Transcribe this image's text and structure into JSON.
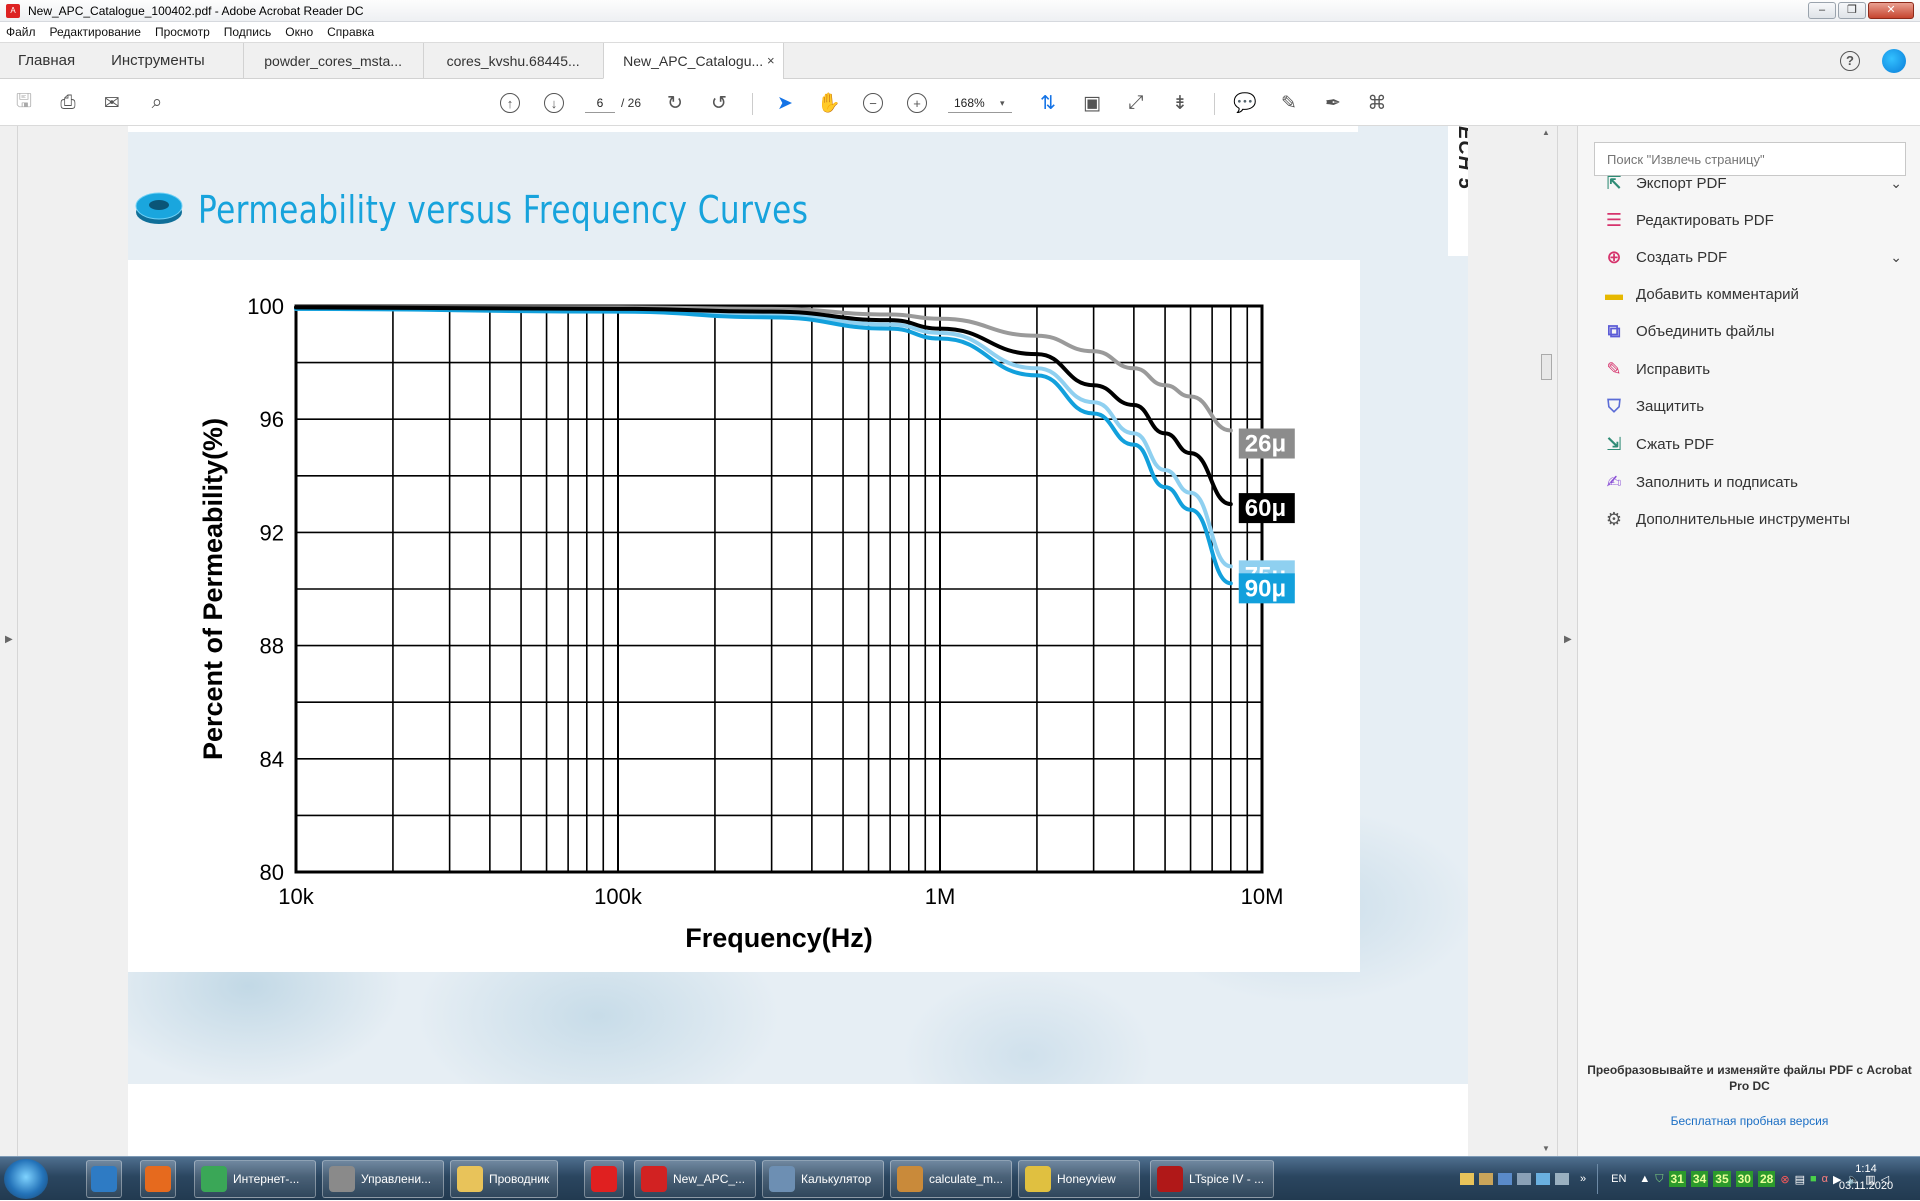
{
  "window": {
    "title": "New_APC_Catalogue_100402.pdf - Adobe Acrobat Reader DC",
    "controls": {
      "minimize": "–",
      "maximize": "❐",
      "close": "✕"
    }
  },
  "menu": [
    "Файл",
    "Редактирование",
    "Просмотр",
    "Подпись",
    "Окно",
    "Справка"
  ],
  "tabs": {
    "home": "Главная",
    "tools": "Инструменты",
    "documents": [
      {
        "label": "powder_cores_msta...",
        "active": false
      },
      {
        "label": "cores_kvshu.68445...",
        "active": false
      },
      {
        "label": "New_APC_Catalogu...",
        "active": true
      }
    ],
    "close_glyph": "×",
    "help": "?"
  },
  "toolbar": {
    "page_current": "6",
    "page_separator": "/ 26",
    "zoom": "168%",
    "zoom_arrow": "▾",
    "icons": [
      "save-icon",
      "print-icon",
      "mail-icon",
      "search-icon",
      "prev-page-icon",
      "next-page-icon",
      "rotate-cw-icon",
      "rotate-ccw-icon",
      "select-cursor-icon",
      "hand-icon",
      "zoom-out-icon",
      "zoom-in-icon",
      "fit-page-icon",
      "page-thumbnail-icon",
      "fullscreen-icon",
      "scroll-mode-icon",
      "comment-icon",
      "highlight-icon",
      "sign-icon",
      "stamp-icon"
    ]
  },
  "document": {
    "side_tab_text": "ECH 5",
    "section_title": "Permeability versus Frequency Curves",
    "accent_color": "#17a3dc"
  },
  "chart_data": {
    "type": "line",
    "title": "",
    "xlabel": "Frequency(Hz)",
    "ylabel": "Percent of Permeability(%)",
    "xscale": "log",
    "xlim": [
      10000,
      10000000
    ],
    "ylim": [
      80,
      100
    ],
    "x_ticks": [
      {
        "value": 10000,
        "label": "10k"
      },
      {
        "value": 100000,
        "label": "100k"
      },
      {
        "value": 1000000,
        "label": "1M"
      },
      {
        "value": 10000000,
        "label": "10M"
      }
    ],
    "y_ticks": [
      100,
      96,
      92,
      88,
      84,
      80
    ],
    "grid": true,
    "series": [
      {
        "name": "26μ",
        "color": "#9a9a9a",
        "label_color": "#8c8c8c",
        "points": [
          [
            10000,
            99.95
          ],
          [
            100000,
            99.95
          ],
          [
            300000,
            99.9
          ],
          [
            700000,
            99.7
          ],
          [
            1000000,
            99.55
          ],
          [
            2000000,
            98.95
          ],
          [
            3000000,
            98.4
          ],
          [
            4000000,
            97.8
          ],
          [
            5000000,
            97.2
          ],
          [
            6000000,
            96.8
          ],
          [
            8000000,
            95.6
          ]
        ]
      },
      {
        "name": "60μ",
        "color": "#000000",
        "label_color": "#000000",
        "points": [
          [
            10000,
            99.95
          ],
          [
            100000,
            99.9
          ],
          [
            300000,
            99.8
          ],
          [
            700000,
            99.5
          ],
          [
            1000000,
            99.2
          ],
          [
            2000000,
            98.3
          ],
          [
            3000000,
            97.2
          ],
          [
            4000000,
            96.5
          ],
          [
            5000000,
            95.5
          ],
          [
            6000000,
            94.8
          ],
          [
            8000000,
            93.0
          ]
        ]
      },
      {
        "name": "75μ",
        "color": "#8fd0f0",
        "label_color": "#8fd0f0",
        "points": [
          [
            10000,
            99.9
          ],
          [
            100000,
            99.85
          ],
          [
            300000,
            99.7
          ],
          [
            700000,
            99.35
          ],
          [
            1000000,
            99.05
          ],
          [
            2000000,
            97.8
          ],
          [
            3000000,
            96.6
          ],
          [
            4000000,
            95.5
          ],
          [
            5000000,
            94.2
          ],
          [
            6000000,
            93.4
          ],
          [
            8000000,
            90.8
          ]
        ]
      },
      {
        "name": "90μ",
        "color": "#12a0dc",
        "label_color": "#12a0dc",
        "points": [
          [
            10000,
            99.9
          ],
          [
            100000,
            99.8
          ],
          [
            300000,
            99.6
          ],
          [
            700000,
            99.2
          ],
          [
            1000000,
            98.85
          ],
          [
            2000000,
            97.55
          ],
          [
            3000000,
            96.2
          ],
          [
            4000000,
            95.1
          ],
          [
            5000000,
            93.6
          ],
          [
            6000000,
            92.8
          ],
          [
            8000000,
            90.2
          ]
        ]
      }
    ]
  },
  "right_panel": {
    "search_placeholder": "Поиск \"Извлечь страницу\"",
    "tools": [
      {
        "label": "Экспорт PDF",
        "icon": "export-pdf-icon",
        "color": "#2f8c76",
        "glyph": "⇱",
        "chevron": true
      },
      {
        "label": "Редактировать PDF",
        "icon": "edit-pdf-icon",
        "color": "#d6336c",
        "glyph": "☰",
        "chevron": false
      },
      {
        "label": "Создать PDF",
        "icon": "create-pdf-icon",
        "color": "#d6336c",
        "glyph": "⊕",
        "chevron": true
      },
      {
        "label": "Добавить комментарий",
        "icon": "comment-icon",
        "color": "#e6b800",
        "glyph": "▬",
        "chevron": false
      },
      {
        "label": "Объединить файлы",
        "icon": "combine-files-icon",
        "color": "#5b5bd6",
        "glyph": "⧉",
        "chevron": false
      },
      {
        "label": "Исправить",
        "icon": "redact-icon",
        "color": "#d6336c",
        "glyph": "✎",
        "chevron": false
      },
      {
        "label": "Защитить",
        "icon": "shield-icon",
        "color": "#5b6cd6",
        "glyph": "⛉",
        "chevron": false
      },
      {
        "label": "Сжать PDF",
        "icon": "compress-pdf-icon",
        "color": "#2f8c76",
        "glyph": "⇲",
        "chevron": false
      },
      {
        "label": "Заполнить и подписать",
        "icon": "fill-sign-icon",
        "color": "#8a4fd6",
        "glyph": "✍",
        "chevron": false
      },
      {
        "label": "Дополнительные инструменты",
        "icon": "more-tools-icon",
        "color": "#555555",
        "glyph": "⚙",
        "chevron": false
      }
    ],
    "chevron_glyph": "⌄",
    "promo": "Преобразовывайте и изменяйте файлы PDF с Acrobat Pro DC",
    "trial_link": "Бесплатная пробная версия"
  },
  "taskbar": {
    "apps": [
      {
        "label": "",
        "name": "taskbar-media-player",
        "color": "#2e7bc4"
      },
      {
        "label": "",
        "name": "taskbar-firefox",
        "color": "#e66a1e"
      },
      {
        "label": "Интернет-...",
        "name": "taskbar-chrome",
        "color": "#3aa757"
      },
      {
        "label": "Управлени...",
        "name": "taskbar-device-manager",
        "color": "#8a8a8a"
      },
      {
        "label": "Проводник",
        "name": "taskbar-explorer",
        "color": "#e8c35a"
      },
      {
        "label": "",
        "name": "taskbar-yandex",
        "color": "#e02020"
      },
      {
        "label": "New_APC_...",
        "name": "taskbar-acrobat",
        "color": "#d22222"
      },
      {
        "label": "Калькулятор",
        "name": "taskbar-calculator",
        "color": "#6d8fb3"
      },
      {
        "label": "calculate_m...",
        "name": "taskbar-paint",
        "color": "#c98a3a"
      },
      {
        "label": "Honeyview",
        "name": "taskbar-honeyview",
        "color": "#e0c040"
      },
      {
        "label": "LTspice IV - ...",
        "name": "taskbar-ltspice",
        "color": "#b01818"
      }
    ],
    "tray": {
      "language": "EN",
      "numbers": [
        "31",
        "34",
        "35",
        "30",
        "28"
      ],
      "time": "1:14",
      "date": "03.11.2020"
    }
  }
}
